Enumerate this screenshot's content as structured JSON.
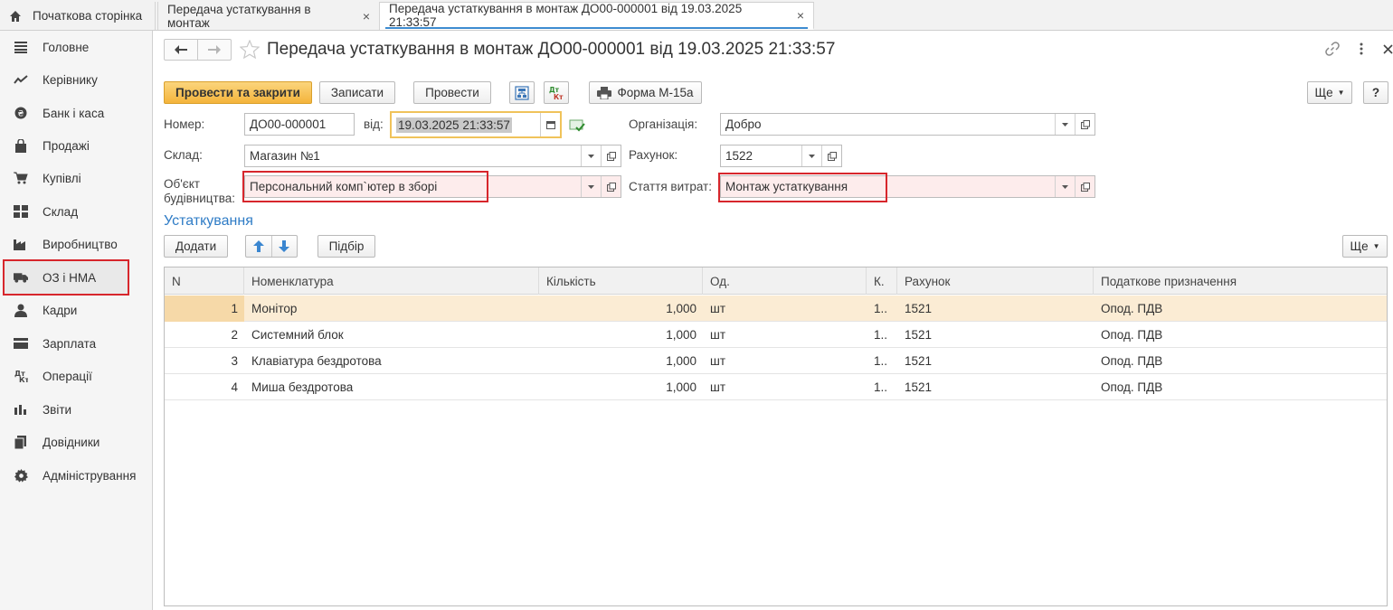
{
  "tabs": {
    "home": "Початкова сторінка",
    "tab1": "Передача устаткування в монтаж",
    "tab2": "Передача устаткування в монтаж ДО00-000001 від 19.03.2025 21:33:57",
    "close": "×"
  },
  "sidebar": {
    "items": [
      {
        "label": "Головне",
        "icon": "menu-icon"
      },
      {
        "label": "Керівнику",
        "icon": "trend-icon"
      },
      {
        "label": "Банк і каса",
        "icon": "coin-icon"
      },
      {
        "label": "Продажі",
        "icon": "bag-icon"
      },
      {
        "label": "Купівлі",
        "icon": "cart-icon"
      },
      {
        "label": "Склад",
        "icon": "warehouse-icon"
      },
      {
        "label": "Виробництво",
        "icon": "factory-icon"
      },
      {
        "label": "ОЗ і НМА",
        "icon": "truck-icon"
      },
      {
        "label": "Кадри",
        "icon": "person-icon"
      },
      {
        "label": "Зарплата",
        "icon": "card-icon"
      },
      {
        "label": "Операції",
        "icon": "operations-icon"
      },
      {
        "label": "Звіти",
        "icon": "chart-icon"
      },
      {
        "label": "Довідники",
        "icon": "books-icon"
      },
      {
        "label": "Адміністрування",
        "icon": "gear-icon"
      }
    ]
  },
  "document": {
    "title": "Передача устаткування в монтаж ДО00-000001 від 19.03.2025 21:33:57"
  },
  "toolbar": {
    "post_close": "Провести та закрити",
    "save": "Записати",
    "post": "Провести",
    "form": "Форма М-15а",
    "more": "Ще",
    "help": "?",
    "dt_kt": "Дт Кт"
  },
  "form": {
    "number_label": "Номер:",
    "number_value": "ДО00-000001",
    "date_label": "від:",
    "date_value": "19.03.2025 21:33:57",
    "org_label": "Організація:",
    "org_value": "Добро",
    "warehouse_label": "Склад:",
    "warehouse_value": "Магазин №1",
    "account_label": "Рахунок:",
    "account_value": "1522",
    "object_label_1": "Об'єкт",
    "object_label_2": "будівництва:",
    "object_value": "Персональний комп`ютер в зборі",
    "expense_label": "Стаття витрат:",
    "expense_value": "Монтаж устаткування"
  },
  "equipment": {
    "title": "Устаткування",
    "add": "Додати",
    "pick": "Підбір",
    "more": "Ще",
    "columns": [
      "N",
      "Номенклатура",
      "Кількість",
      "Од.",
      "К.",
      "Рахунок",
      "Податкове призначення"
    ],
    "rows": [
      {
        "n": "1",
        "item": "Монітор",
        "qty": "1,000",
        "unit": "шт",
        "k": "1..",
        "account": "1521",
        "tax": "Опод. ПДВ"
      },
      {
        "n": "2",
        "item": "Системний блок",
        "qty": "1,000",
        "unit": "шт",
        "k": "1..",
        "account": "1521",
        "tax": "Опод. ПДВ"
      },
      {
        "n": "3",
        "item": "Клавіатура бездротова",
        "qty": "1,000",
        "unit": "шт",
        "k": "1..",
        "account": "1521",
        "tax": "Опод. ПДВ"
      },
      {
        "n": "4",
        "item": "Миша бездротова",
        "qty": "1,000",
        "unit": "шт",
        "k": "1..",
        "account": "1521",
        "tax": "Опод. ПДВ"
      }
    ]
  },
  "colors": {
    "accent": "#2f7cc6",
    "primary_button": "#f4b43b",
    "highlight": "#d7262c",
    "selected_row": "#fbecd4"
  }
}
